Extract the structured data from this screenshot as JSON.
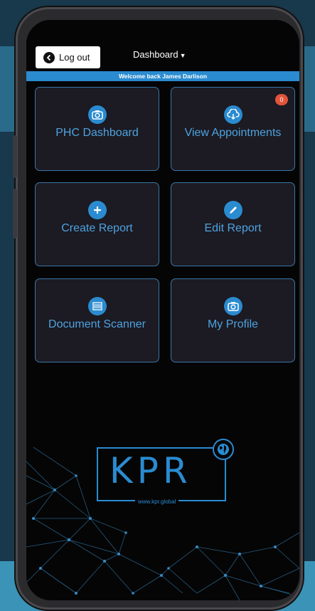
{
  "header": {
    "logout_label": "Log out",
    "title": "Dashboard",
    "welcome": "Welcome back James Darlison"
  },
  "tiles": [
    {
      "label": "PHC Dashboard",
      "icon": "camera-icon"
    },
    {
      "label": "View Appointments",
      "icon": "cloud-download-icon",
      "badge": "0"
    },
    {
      "label": "Create Report",
      "icon": "plus-icon"
    },
    {
      "label": "Edit Report",
      "icon": "pencil-icon"
    },
    {
      "label": "Document Scanner",
      "icon": "scanner-icon"
    },
    {
      "label": "My Profile",
      "icon": "camera-icon"
    }
  ],
  "logo": {
    "text": "KPR",
    "url": "www.kpr.global"
  },
  "colors": {
    "accent": "#2a8bd0",
    "tile_bg": "#1c1a22",
    "tile_border": "#3a78a8",
    "badge": "#e0543a"
  }
}
